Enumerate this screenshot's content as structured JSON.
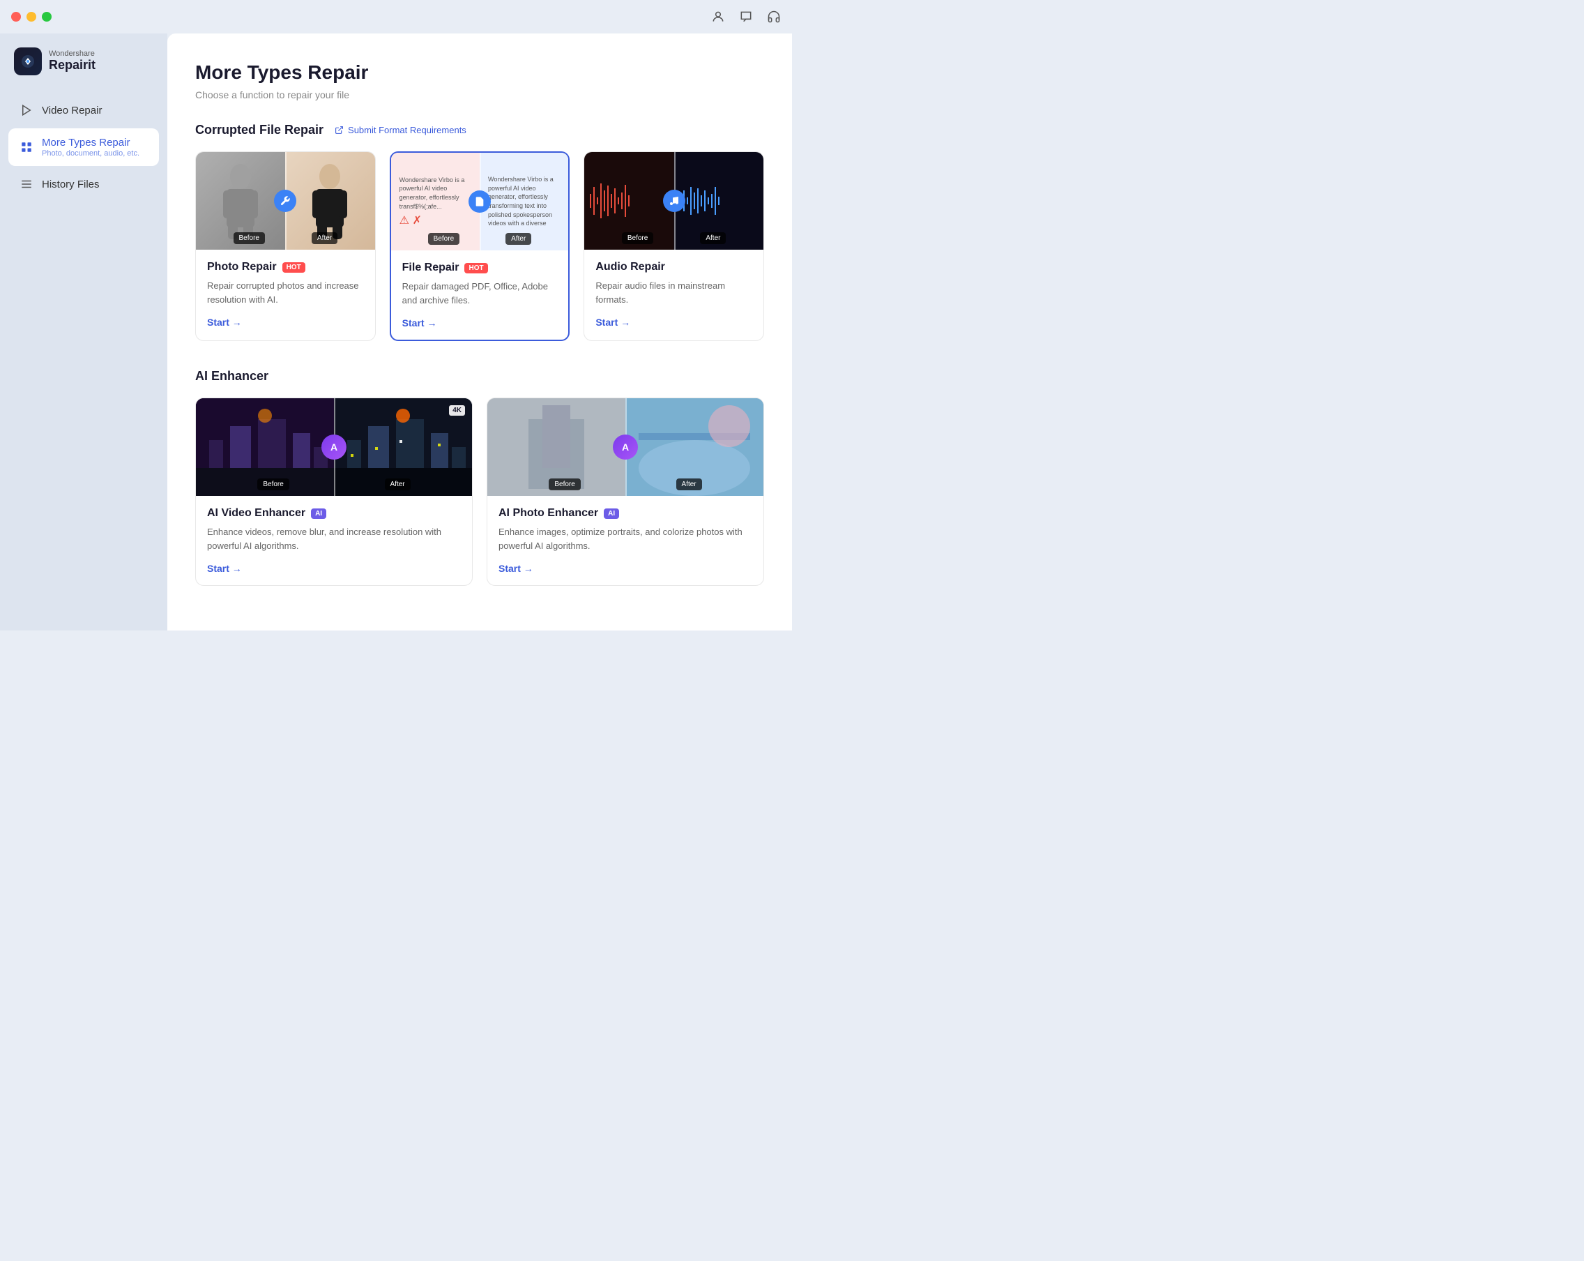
{
  "titlebar": {
    "traffic_lights": [
      "red",
      "yellow",
      "green"
    ]
  },
  "app": {
    "logo_company": "Wondershare",
    "logo_name": "Repairit"
  },
  "sidebar": {
    "items": [
      {
        "id": "video-repair",
        "label": "Video Repair",
        "sub": "",
        "active": false
      },
      {
        "id": "more-types-repair",
        "label": "More Types Repair",
        "sub": "Photo, document, audio, etc.",
        "active": true
      },
      {
        "id": "history-files",
        "label": "History Files",
        "sub": "",
        "active": false
      }
    ]
  },
  "main": {
    "title": "More Types Repair",
    "subtitle": "Choose a function to repair your file",
    "sections": [
      {
        "id": "corrupted-file-repair",
        "title": "Corrupted File Repair",
        "submit_link": "Submit Format Requirements",
        "cards": [
          {
            "id": "photo-repair",
            "title": "Photo Repair",
            "badge": "HOT",
            "badge_type": "hot",
            "description": "Repair corrupted photos and increase resolution with AI.",
            "start_label": "Start →"
          },
          {
            "id": "file-repair",
            "title": "File Repair",
            "badge": "HOT",
            "badge_type": "hot",
            "description": "Repair damaged PDF, Office, Adobe and archive files.",
            "start_label": "Start →",
            "selected": true
          },
          {
            "id": "audio-repair",
            "title": "Audio Repair",
            "badge": "",
            "badge_type": "",
            "description": "Repair audio files in mainstream formats.",
            "start_label": "Start →"
          }
        ]
      },
      {
        "id": "ai-enhancer",
        "title": "AI Enhancer",
        "cards": [
          {
            "id": "ai-video-enhancer",
            "title": "AI Video Enhancer",
            "badge": "AI",
            "badge_type": "ai",
            "description": "Enhance videos, remove blur, and increase resolution with powerful AI algorithms.",
            "start_label": "Start →",
            "has_4k": true
          },
          {
            "id": "ai-photo-enhancer",
            "title": "AI Photo Enhancer",
            "badge": "AI",
            "badge_type": "ai",
            "description": "Enhance images, optimize portraits, and colorize photos with powerful AI algorithms.",
            "start_label": "Start →",
            "has_4k": false
          }
        ]
      }
    ]
  }
}
